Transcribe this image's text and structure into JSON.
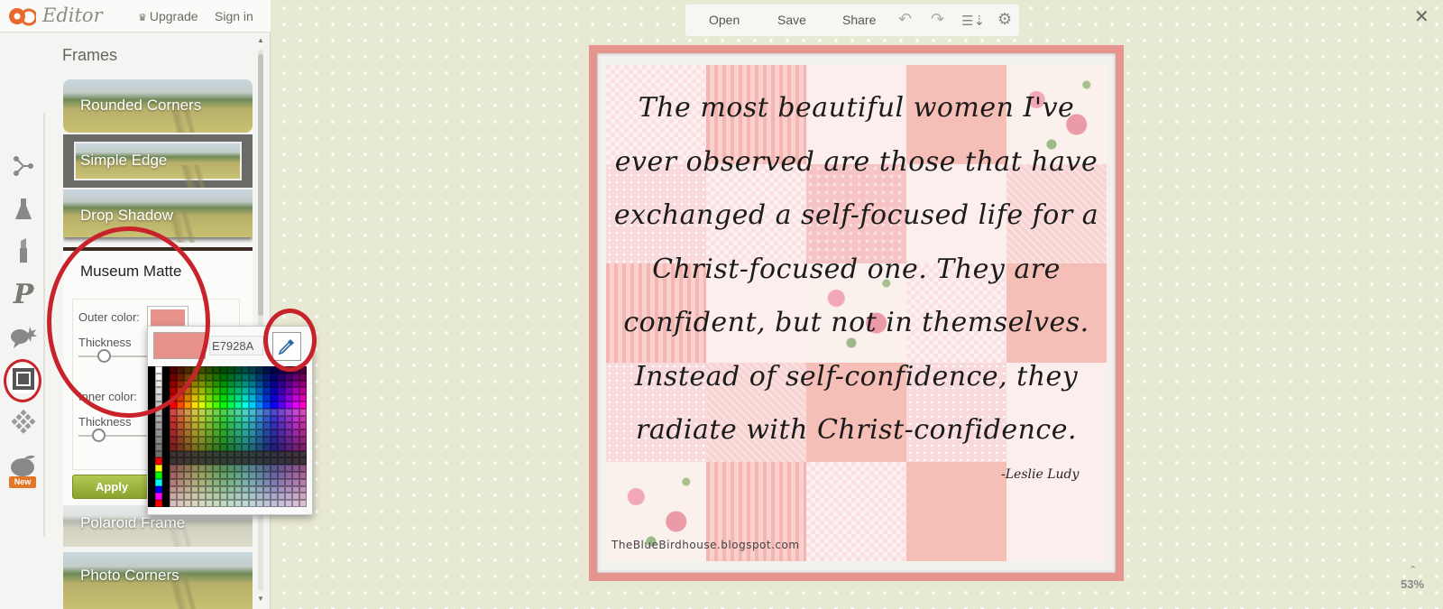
{
  "app": {
    "logo_text": "Editor",
    "upgrade_label": "Upgrade",
    "signin_label": "Sign in"
  },
  "sidebar": {
    "section_title": "Frames",
    "frames": [
      {
        "label": "Rounded Corners"
      },
      {
        "label": "Simple Edge"
      },
      {
        "label": "Drop Shadow"
      },
      {
        "label": "Museum Matte"
      },
      {
        "label": "Polaroid Frame"
      },
      {
        "label": "Photo Corners"
      }
    ],
    "rail_icons": [
      "basics-icon",
      "effects-icon",
      "touch-up-icon",
      "text-icon",
      "overlays-icon",
      "frames-icon",
      "textures-icon",
      "seasonal-icon"
    ],
    "new_badge": "New"
  },
  "museum": {
    "title": "Museum Matte",
    "outer_color_label": "Outer color:",
    "outer_color": "#E7928A",
    "thickness_label": "Thickness",
    "outer_thickness": 0.35,
    "inner_color_label": "Inner color:",
    "inner_thickness_label": "Thickness",
    "inner_thickness": 0.28,
    "apply_label": "Apply"
  },
  "picker": {
    "hex_value": "E7928A",
    "preview_color": "#E7928A"
  },
  "toolbar": {
    "open": "Open",
    "save": "Save",
    "share": "Share"
  },
  "canvas": {
    "quote_lines": [
      "The most beautiful women I've",
      "ever observed are those that have",
      "exchanged a self-focused life for a",
      "Christ-focused one. They are",
      "confident, but not in themselves.",
      "Instead of self-confidence, they",
      "radiate with Christ-confidence."
    ],
    "signature": "-Leslie Ludy",
    "credit": "TheBlueBirdhouse.blogspot.com",
    "frame_color": "#E59490",
    "zoom": "53%"
  },
  "colors": {
    "annotation": "#C8232A",
    "apply_green": "#9AB23A"
  }
}
